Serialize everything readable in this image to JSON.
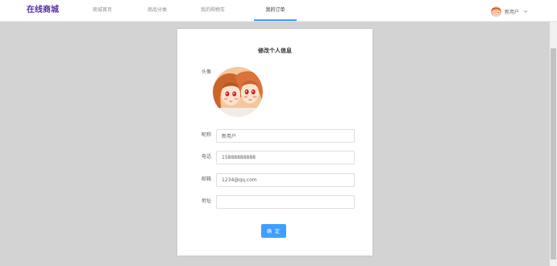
{
  "app": {
    "brand": "在线商城"
  },
  "nav": {
    "items": [
      {
        "label": "商城首页",
        "active": false
      },
      {
        "label": "商品分类",
        "active": false
      },
      {
        "label": "我的购物车",
        "active": false
      },
      {
        "label": "我的订单",
        "active": true
      }
    ],
    "user": {
      "name": "新用户",
      "avatar_icon": "cartoon-avatar",
      "caret_icon": "chevron-down-icon"
    }
  },
  "form": {
    "title": "修改个人信息",
    "avatar_label": "头像",
    "fields": [
      {
        "label": "昵称",
        "value": "新用户",
        "placeholder": ""
      },
      {
        "label": "电话",
        "value": "15888888888",
        "placeholder": ""
      },
      {
        "label": "邮箱",
        "value": "1234@qq.com",
        "placeholder": ""
      },
      {
        "label": "地址",
        "value": "",
        "placeholder": ""
      }
    ],
    "submit_label": "确 定"
  },
  "colors": {
    "brand": "#5a2ea6",
    "primary": "#409eff",
    "background": "#d3d3d3"
  }
}
